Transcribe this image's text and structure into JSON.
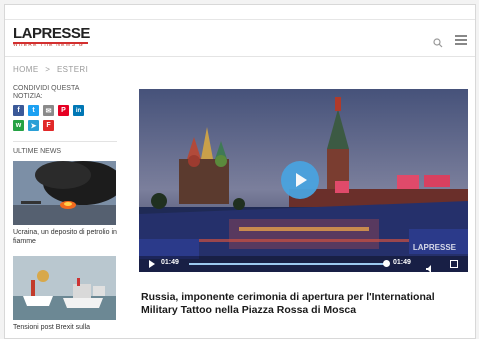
{
  "brand": {
    "name": "LAPRESSE",
    "tagline": "WHERE THE NEWS G"
  },
  "breadcrumb": [
    "HOME",
    ">",
    "ESTERI"
  ],
  "share": {
    "title": "CONDIVIDI QUESTA NOTIZIA:",
    "buttons": [
      {
        "icon": "facebook-icon",
        "glyph": "f",
        "color": "#3b5998"
      },
      {
        "icon": "twitter-icon",
        "glyph": "t",
        "color": "#1da1f2"
      },
      {
        "icon": "email-icon",
        "glyph": "✉",
        "color": "#8a8a8a"
      },
      {
        "icon": "pinterest-icon",
        "glyph": "P",
        "color": "#e60023"
      },
      {
        "icon": "linkedin-icon",
        "glyph": "in",
        "color": "#0077b5"
      },
      {
        "icon": "whatsapp-icon",
        "glyph": "w",
        "color": "#25a244"
      },
      {
        "icon": "telegram-icon",
        "glyph": "➤",
        "color": "#2a9fd6"
      },
      {
        "icon": "flipboard-icon",
        "glyph": "F",
        "color": "#e12828"
      }
    ]
  },
  "ultime": {
    "title": "ULTIME NEWS",
    "items": [
      {
        "caption": "Ucraina, un deposito di petrolio in fiamme"
      },
      {
        "caption": "Tensioni post Brexit sulla"
      }
    ]
  },
  "video": {
    "current_time": "01:49",
    "duration": "01:49",
    "progress": 1.0,
    "watermark": "LAPRESSE"
  },
  "article": {
    "headline": "Russia, imponente cerimonia di apertura per l'International Military Tattoo nella Piazza Rossa di Mosca"
  }
}
